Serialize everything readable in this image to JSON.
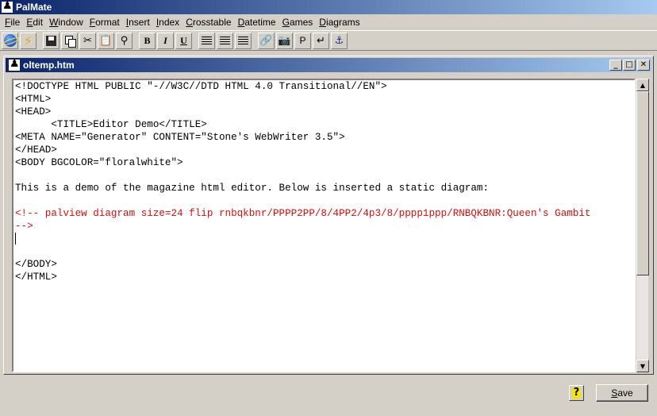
{
  "app": {
    "title": "PalMate"
  },
  "menu": [
    {
      "label": "File",
      "mnemonic": "F",
      "rest": "ile"
    },
    {
      "label": "Edit",
      "mnemonic": "E",
      "rest": "dit"
    },
    {
      "label": "Window",
      "mnemonic": "W",
      "rest": "indow"
    },
    {
      "label": "Format",
      "mnemonic": "F",
      "rest": "ormat"
    },
    {
      "label": "Insert",
      "mnemonic": "I",
      "rest": "nsert"
    },
    {
      "label": "Index",
      "mnemonic": "I",
      "rest": "ndex"
    },
    {
      "label": "Crosstable",
      "mnemonic": "C",
      "rest": "rosstable"
    },
    {
      "label": "Datetime",
      "mnemonic": "D",
      "rest": "atetime"
    },
    {
      "label": "Games",
      "mnemonic": "G",
      "rest": "ames"
    },
    {
      "label": "Diagrams",
      "mnemonic": "D",
      "rest": "iagrams"
    }
  ],
  "toolbar": {
    "bold": "B",
    "italic": "I",
    "underline": "U",
    "paragraph": "P",
    "icons": [
      "globe-icon",
      "lightning-icon",
      "save-icon",
      "copy-icon",
      "cut-icon",
      "paste-icon",
      "find-icon",
      "bold-icon",
      "italic-icon",
      "underline-icon",
      "align-left-icon",
      "align-center-icon",
      "align-justify-icon",
      "link-icon",
      "image-icon",
      "paragraph-icon",
      "line-break-icon",
      "anchor-icon"
    ]
  },
  "document": {
    "title": "oltemp.htm",
    "lines": [
      {
        "text": "<!DOCTYPE HTML PUBLIC \"-//W3C//DTD HTML 4.0 Transitional//EN\">",
        "color": "#000000"
      },
      {
        "text": "<HTML>",
        "color": "#000000"
      },
      {
        "text": "<HEAD>",
        "color": "#000000"
      },
      {
        "text": "      <TITLE>Editor Demo</TITLE>",
        "color": "#000000"
      },
      {
        "text": "<META NAME=\"Generator\" CONTENT=\"Stone's WebWriter 3.5\">",
        "color": "#000000"
      },
      {
        "text": "</HEAD>",
        "color": "#000000"
      },
      {
        "text": "<BODY BGCOLOR=\"floralwhite\">",
        "color": "#000000"
      },
      {
        "text": "",
        "color": "#000000"
      },
      {
        "text": "This is a demo of the magazine html editor. Below is inserted a static diagram:",
        "color": "#000000"
      },
      {
        "text": "",
        "color": "#000000"
      },
      {
        "text": "<!-- palview diagram size=24 flip rnbqkbnr/PPPP2PP/8/4PP2/4p3/8/pppp1ppp/RNBQKBNR:Queen's Gambit",
        "color": "#d01010"
      },
      {
        "text": "-->",
        "color": "#d01010"
      },
      {
        "text": "",
        "color": "#000000",
        "caret": true
      },
      {
        "text": "",
        "color": "#000000"
      },
      {
        "text": "</BODY>",
        "color": "#000000"
      },
      {
        "text": "</HTML>",
        "color": "#000000"
      }
    ]
  },
  "buttons": {
    "help": "?",
    "save_mnemonic": "S",
    "save_rest": "ave"
  },
  "colors": {
    "titlebar_start": "#0a246a",
    "titlebar_end": "#a6caf0",
    "comment_text": "#d01010",
    "help_icon_bg": "#f5e600"
  }
}
